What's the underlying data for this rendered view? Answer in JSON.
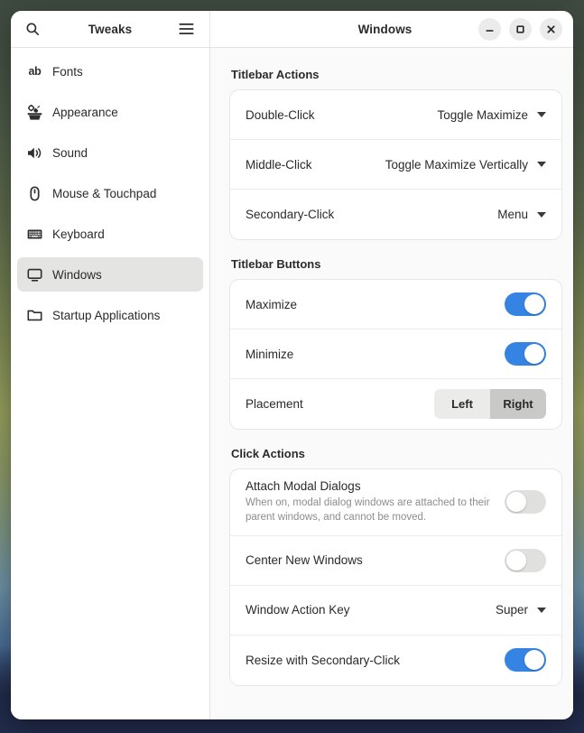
{
  "header": {
    "sidebar_title": "Tweaks",
    "content_title": "Windows",
    "search_icon": "search-icon",
    "menu_icon": "hamburger-menu-icon",
    "window_controls": {
      "minimize": "minimize-icon",
      "maximize": "maximize-icon",
      "close": "close-icon"
    }
  },
  "sidebar": {
    "items": [
      {
        "label": "Fonts",
        "icon": "font-ab-icon",
        "selected": false
      },
      {
        "label": "Appearance",
        "icon": "preferences-gear-wrench-icon",
        "selected": false
      },
      {
        "label": "Sound",
        "icon": "speaker-volume-icon",
        "selected": false
      },
      {
        "label": "Mouse & Touchpad",
        "icon": "mouse-icon",
        "selected": false
      },
      {
        "label": "Keyboard",
        "icon": "keyboard-icon",
        "selected": false
      },
      {
        "label": "Windows",
        "icon": "window-monitor-icon",
        "selected": true
      },
      {
        "label": "Startup Applications",
        "icon": "folder-icon",
        "selected": false
      }
    ]
  },
  "content": {
    "sections": [
      {
        "title": "Titlebar Actions",
        "rows": [
          {
            "type": "dropdown",
            "label": "Double-Click",
            "value": "Toggle Maximize"
          },
          {
            "type": "dropdown",
            "label": "Middle-Click",
            "value": "Toggle Maximize Vertically"
          },
          {
            "type": "dropdown",
            "label": "Secondary-Click",
            "value": "Menu"
          }
        ]
      },
      {
        "title": "Titlebar Buttons",
        "rows": [
          {
            "type": "toggle",
            "label": "Maximize",
            "state": "on"
          },
          {
            "type": "toggle",
            "label": "Minimize",
            "state": "on"
          },
          {
            "type": "segmented",
            "label": "Placement",
            "options": [
              "Left",
              "Right"
            ],
            "selected": "Right"
          }
        ]
      },
      {
        "title": "Click Actions",
        "rows": [
          {
            "type": "toggle",
            "label": "Attach Modal Dialogs",
            "subtitle": "When on, modal dialog windows are attached to their parent windows, and cannot be moved.",
            "state": "off"
          },
          {
            "type": "toggle",
            "label": "Center New Windows",
            "state": "off"
          },
          {
            "type": "dropdown",
            "label": "Window Action Key",
            "value": "Super"
          },
          {
            "type": "toggle",
            "label": "Resize with Secondary-Click",
            "state": "on"
          }
        ]
      }
    ]
  },
  "colors": {
    "accent_blue": "#3584e4",
    "toggle_off": "#e0e0de",
    "segment_selected": "#c9c9c7",
    "sidebar_selected": "#e4e4e2"
  }
}
